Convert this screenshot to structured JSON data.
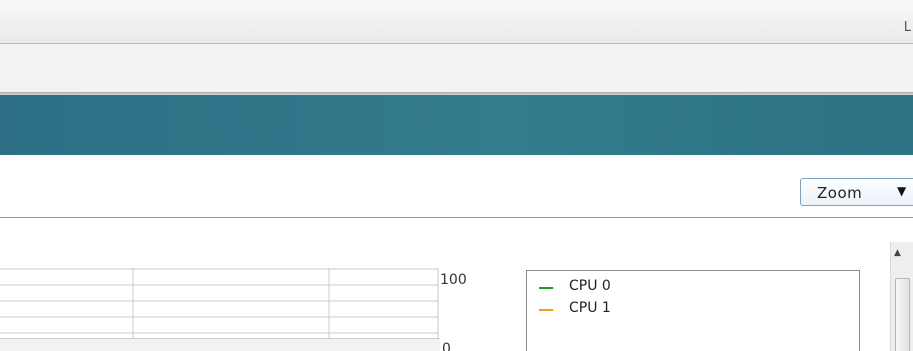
{
  "window": {
    "title_fragment": "L"
  },
  "toolbar": {
    "zoom": {
      "label": "Zoom",
      "icon": "chevron-down-icon"
    }
  },
  "chart": {
    "y_max_label": "100",
    "y_min_label": "0",
    "legend": [
      {
        "label": "CPU 0",
        "color": "#2a9a2a"
      },
      {
        "label": "CPU 1",
        "color": "#f0a020"
      }
    ]
  },
  "colors": {
    "header_band": "#327c8c",
    "zoom_border": "#7ba3c4"
  }
}
